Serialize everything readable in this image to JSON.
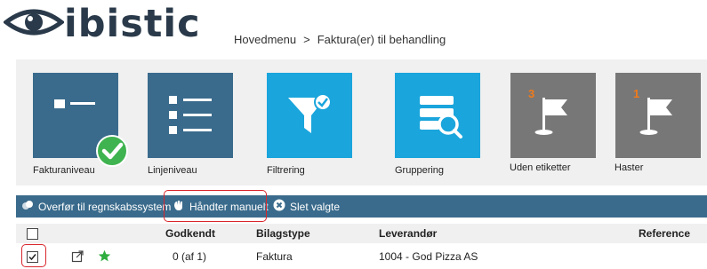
{
  "brand": {
    "name": "ibistic",
    "logo_icon": "eye-icon"
  },
  "breadcrumb": {
    "home": "Hovedmenu",
    "separator": ">",
    "current": "Faktura(er) til behandling"
  },
  "tiles": [
    {
      "label": "Fakturaniveau",
      "icon": "invoice-level-icon",
      "color": "#3a6b8c",
      "checked": true
    },
    {
      "label": "Linjeniveau",
      "icon": "list-icon",
      "color": "#3a6b8c"
    },
    {
      "label": "Filtrering",
      "icon": "filter-icon",
      "color": "#1aa5dc"
    },
    {
      "label": "Gruppering",
      "icon": "grouping-icon",
      "color": "#1aa5dc"
    },
    {
      "label": "Uden etiketter",
      "icon": "flag-icon",
      "color": "#777777",
      "count": "3"
    },
    {
      "label": "Haster",
      "icon": "flag-icon",
      "color": "#777777",
      "count": "1"
    }
  ],
  "toolbar": {
    "transfer": "Overfør til regnskabssystem",
    "manual": "Håndter manuelt",
    "delete": "Slet valgte"
  },
  "table": {
    "headers": {
      "approved": "Godkendt",
      "doc_type": "Bilagstype",
      "supplier": "Leverandør",
      "reference": "Reference"
    },
    "rows": [
      {
        "selected": true,
        "favorite": true,
        "approved": "0 (af 1)",
        "doc_type": "Faktura",
        "supplier": "1004 - God Pizza AS",
        "reference": ""
      }
    ]
  },
  "colors": {
    "accent": "#3a6b8c",
    "tile_blue": "#1aa5dc",
    "tile_gray": "#777777",
    "highlight": "#d8262c",
    "badge": "#f07a1a",
    "check": "#3fb34f",
    "star": "#2fae3f"
  }
}
